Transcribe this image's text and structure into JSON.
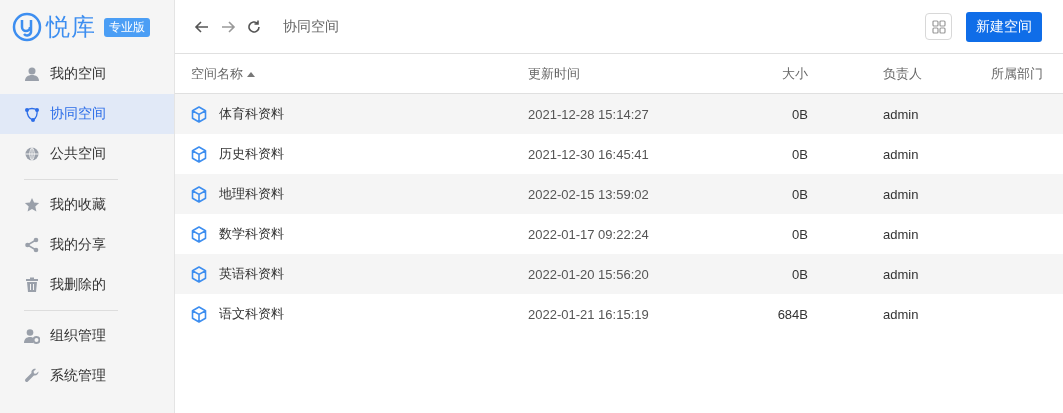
{
  "logo": {
    "name": "悦库",
    "badge": "专业版"
  },
  "sidebar": {
    "groups": [
      [
        {
          "label": "我的空间",
          "selected": false
        },
        {
          "label": "协同空间",
          "selected": true
        },
        {
          "label": "公共空间",
          "selected": false
        }
      ],
      [
        {
          "label": "我的收藏",
          "selected": false
        },
        {
          "label": "我的分享",
          "selected": false
        },
        {
          "label": "我删除的",
          "selected": false
        }
      ],
      [
        {
          "label": "组织管理",
          "selected": false
        },
        {
          "label": "系统管理",
          "selected": false
        }
      ]
    ]
  },
  "toolbar": {
    "breadcrumb": "协同空间",
    "new_button": "新建空间"
  },
  "table": {
    "columns": [
      {
        "label": "空间名称",
        "sorted": true
      },
      {
        "label": "更新时间",
        "sorted": false
      },
      {
        "label": "大小",
        "sorted": false
      },
      {
        "label": "负责人",
        "sorted": false
      },
      {
        "label": "所属部门",
        "sorted": false
      }
    ],
    "rows": [
      {
        "name": "体育科资料",
        "updated": "2021-12-28 15:14:27",
        "size": "0B",
        "owner": "admin"
      },
      {
        "name": "历史科资料",
        "updated": "2021-12-30 16:45:41",
        "size": "0B",
        "owner": "admin"
      },
      {
        "name": "地理科资料",
        "updated": "2022-02-15 13:59:02",
        "size": "0B",
        "owner": "admin"
      },
      {
        "name": "数学科资料",
        "updated": "2022-01-17 09:22:24",
        "size": "0B",
        "owner": "admin"
      },
      {
        "name": "英语科资料",
        "updated": "2022-01-20 15:56:20",
        "size": "0B",
        "owner": "admin"
      },
      {
        "name": "语文科资料",
        "updated": "2022-01-21 16:15:19",
        "size": "684B",
        "owner": "admin"
      }
    ]
  }
}
